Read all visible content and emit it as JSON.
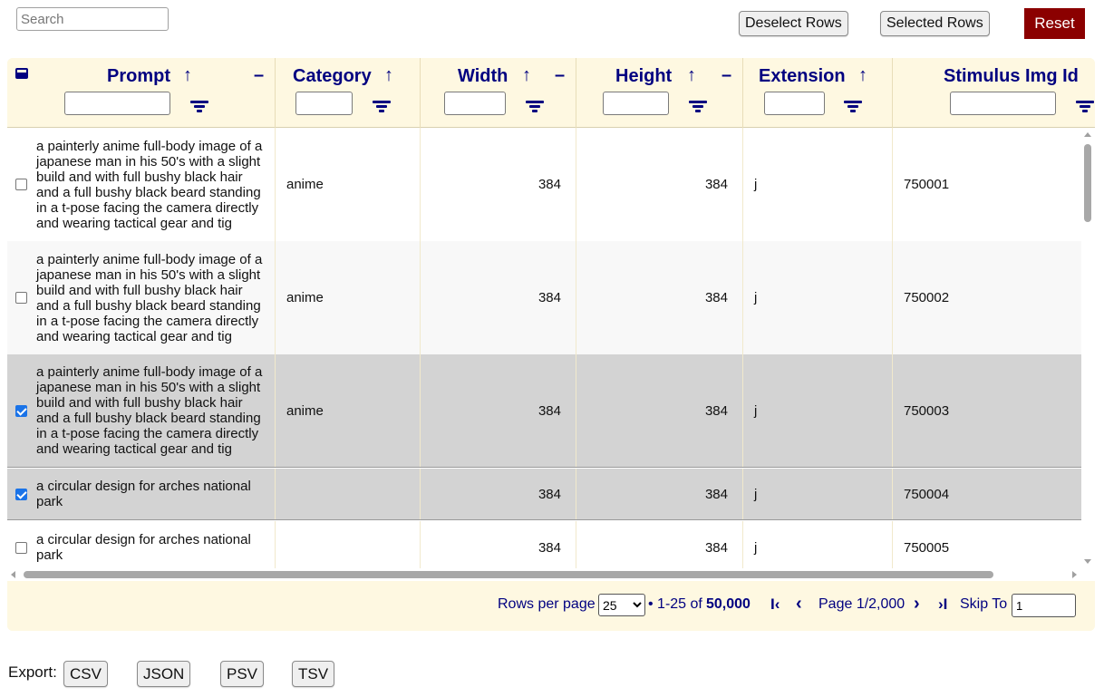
{
  "toolbar": {
    "search_placeholder": "Search",
    "deselect_label": "Deselect Rows",
    "selected_label": "Selected Rows",
    "reset_label": "Reset",
    "reset_color": "#8b0000"
  },
  "table": {
    "header_bg": "#fef8e1",
    "accent": "#000080",
    "columns": [
      {
        "key": "prompt",
        "label": "Prompt"
      },
      {
        "key": "category",
        "label": "Category"
      },
      {
        "key": "width",
        "label": "Width"
      },
      {
        "key": "height",
        "label": "Height"
      },
      {
        "key": "extension",
        "label": "Extension"
      },
      {
        "key": "stimulus_img_id",
        "label": "Stimulus Img Id"
      }
    ],
    "rows": [
      {
        "selected": false,
        "prompt": "a painterly anime full-body image of a japanese man in his 50's with a slight build and with full bushy black hair and a full bushy black beard standing in a t-pose facing the camera directly and wearing tactical gear and tig",
        "category": "anime",
        "width": "384",
        "height": "384",
        "extension": "j",
        "stimulus_img_id": "750001"
      },
      {
        "selected": false,
        "prompt": "a painterly anime full-body image of a japanese man in his 50's with a slight build and with full bushy black hair and a full bushy black beard standing in a t-pose facing the camera directly and wearing tactical gear and tig",
        "category": "anime",
        "width": "384",
        "height": "384",
        "extension": "j",
        "stimulus_img_id": "750002"
      },
      {
        "selected": true,
        "prompt": "a painterly anime full-body image of a japanese man in his 50's with a slight build and with full bushy black hair and a full bushy black beard standing in a t-pose facing the camera directly and wearing tactical gear and tig",
        "category": "anime",
        "width": "384",
        "height": "384",
        "extension": "j",
        "stimulus_img_id": "750003"
      },
      {
        "selected": true,
        "prompt": "a circular design for arches national park",
        "category": "",
        "width": "384",
        "height": "384",
        "extension": "j",
        "stimulus_img_id": "750004"
      },
      {
        "selected": false,
        "prompt": "a circular design for arches national park",
        "category": "",
        "width": "384",
        "height": "384",
        "extension": "j",
        "stimulus_img_id": "750005"
      }
    ]
  },
  "pagination": {
    "rows_per_page_label": "Rows per page",
    "rows_per_page_value": "25",
    "range_text": "• 1-25 of",
    "total": "50,000",
    "page_text": "Page 1/2,000",
    "skip_label": "Skip To",
    "skip_value": "1"
  },
  "export": {
    "label": "Export:",
    "formats": [
      "CSV",
      "JSON",
      "PSV",
      "TSV"
    ]
  }
}
